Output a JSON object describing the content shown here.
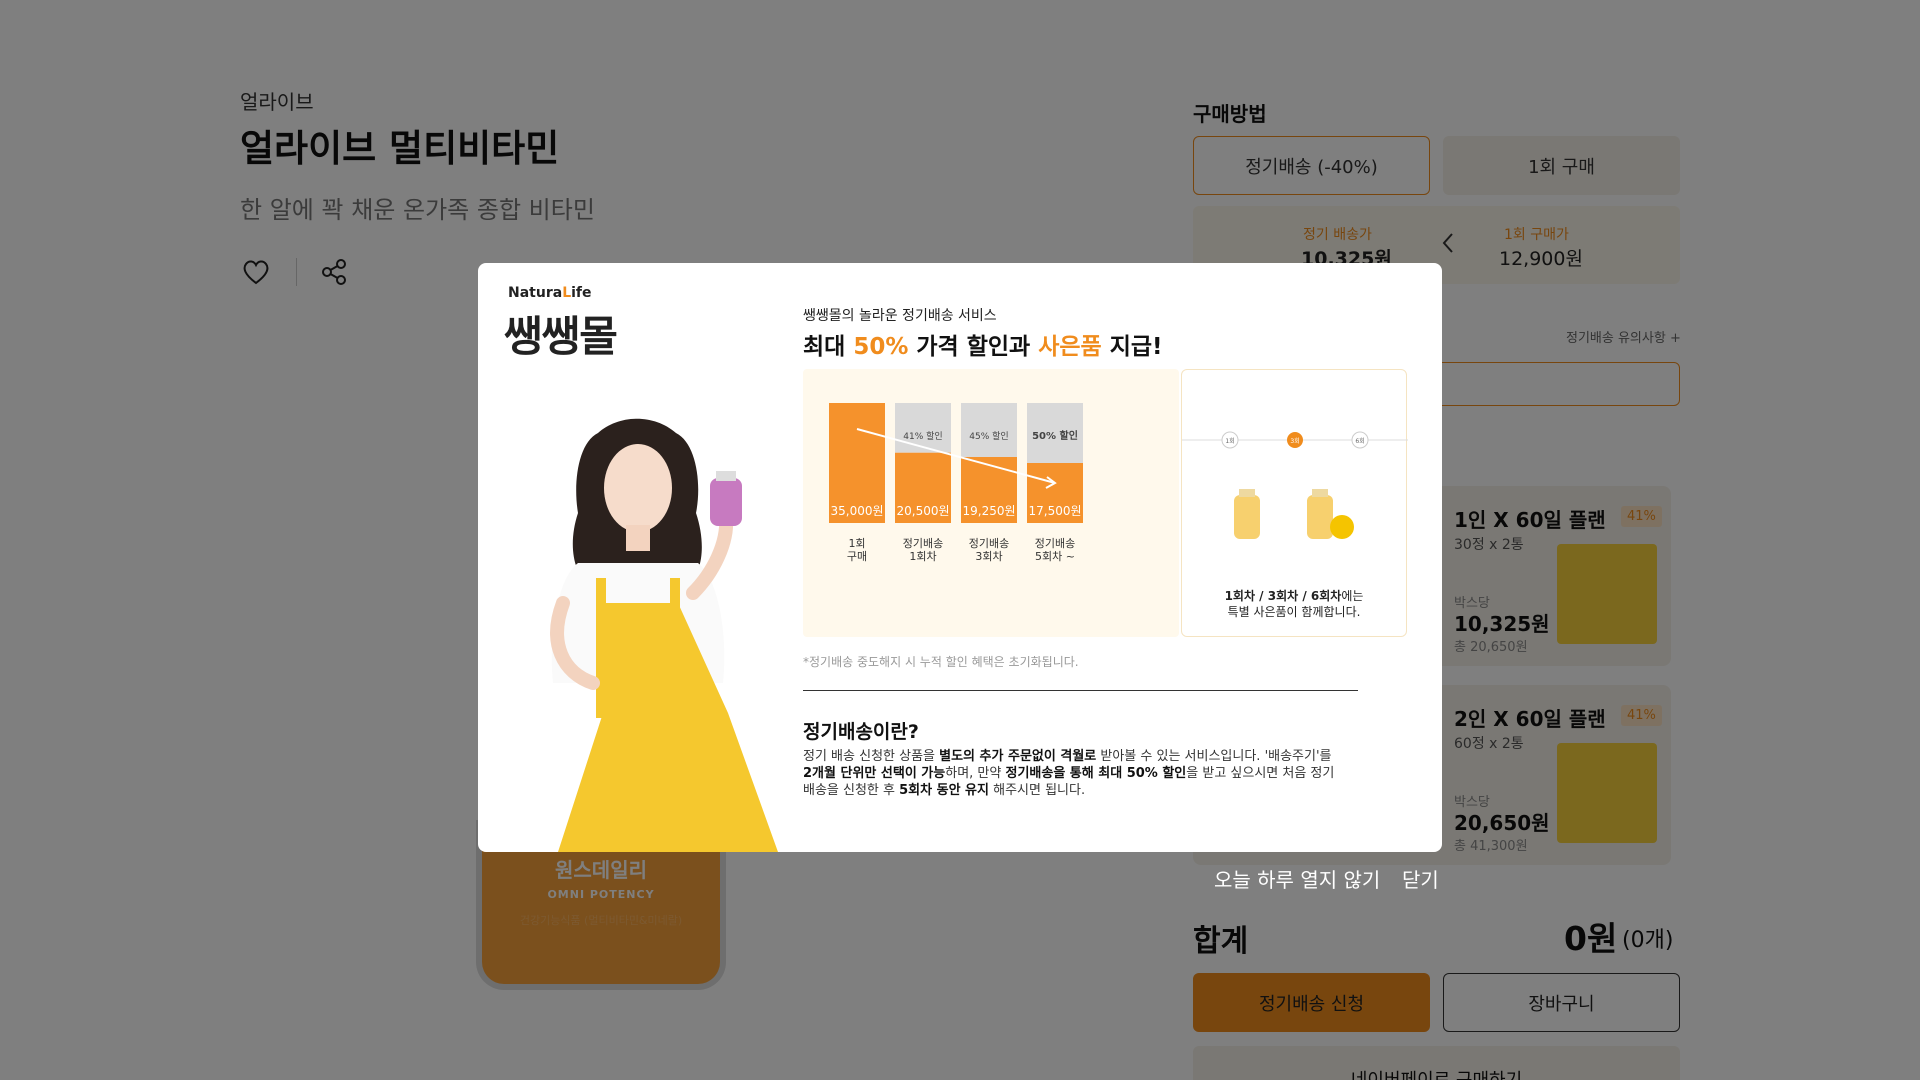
{
  "product": {
    "brand": "얼라이브",
    "title": "얼라이브 멀티비타민",
    "subtitle": "한 알에 꽉 채운 온가족 종합 비타민",
    "bottle_line1": "원스데일리",
    "bottle_line2": "OMNI POTENCY",
    "bottle_line3": "건강기능식품 (멀티비타민&미네랄)"
  },
  "purchase": {
    "section_title": "구매방법",
    "tab_subscription": "정기배송 (-40%)",
    "tab_once": "1회 구매",
    "sub_price_label": "정기 배송가",
    "sub_price_value": "10,325원",
    "once_price_label": "1회 구매가",
    "once_price_value": "12,900원",
    "notice_link": "정기배송 유의사항 +"
  },
  "plans": [
    {
      "name": "1인 X 60일 플랜",
      "badge": "41%",
      "qty": "30정 x 2통",
      "unit_label": "박스당",
      "price": "10,325원",
      "total": "총 20,650원"
    },
    {
      "name": "2인 X 60일 플랜",
      "badge": "41%",
      "qty": "60정 x 2통",
      "unit_label": "박스당",
      "price": "20,650원",
      "total": "총 41,300원"
    }
  ],
  "summary": {
    "label": "합계",
    "value": "0원",
    "count": "(0개)"
  },
  "buttons": {
    "subscribe": "정기배송 신청",
    "cart": "장바구니",
    "naver": "네이버페이로 구매하기"
  },
  "modal": {
    "logo_small_prefix": "Natura",
    "logo_small_accent": "L",
    "logo_small_suffix": "ife",
    "logo_big": "쌩쌩몰",
    "kicker": "쌩쌩몰의 놀라운 정기배송 서비스",
    "headline_1": "최대 ",
    "headline_2": "50%",
    "headline_3": " 가격 할인과 ",
    "headline_4": "사은품",
    "headline_5": " 지급!",
    "footnote": "*정기배송 중도해지 시 누적 할인 혜택은 초기화됩니다.",
    "section_title": "정기배송이란?",
    "para": [
      {
        "t": "정기 배송 신청한 상품을 ",
        "b": false
      },
      {
        "t": "별도의 추가 주문없이 격월로",
        "b": true
      },
      {
        "t": " 받아볼 수 있는 서비스입니다. '배송주기'를 ",
        "b": false
      },
      {
        "t": "2개월 단위만 선택이 가능",
        "b": true
      },
      {
        "t": "하며, 만약 ",
        "b": false
      },
      {
        "t": "정기배송을 통해 최대 50% 할인",
        "b": true
      },
      {
        "t": "을 받고 싶으시면 처음 정기 배송을 신청한 후 ",
        "b": false
      },
      {
        "t": "5회차 동안 유지",
        "b": true
      },
      {
        "t": " 해주시면 됩니다.",
        "b": false
      }
    ],
    "gift": {
      "steps": [
        "1회",
        "3회",
        "6회"
      ],
      "highlight": "1회차 / 3회차 / 6회차",
      "suffix": "에는",
      "line2": "특별 사은품이 함께합니다."
    },
    "dont_show_today": "오늘 하루 열지 않기",
    "close": "닫기"
  },
  "chart_data": {
    "type": "bar",
    "categories": [
      "1회 구매",
      "정기배송 1회차",
      "정기배송 3회차",
      "정기배송 5회차 ~"
    ],
    "values": [
      35000,
      20500,
      19250,
      17500
    ],
    "value_labels": [
      "35,000원",
      "20,500원",
      "19,250원",
      "17,500원"
    ],
    "discount_labels": [
      "",
      "41% 할인",
      "45% 할인",
      "50% 할인"
    ],
    "max": 35000,
    "colors": {
      "bar": "#f5922c",
      "remainder": "#d9d9d9"
    }
  }
}
